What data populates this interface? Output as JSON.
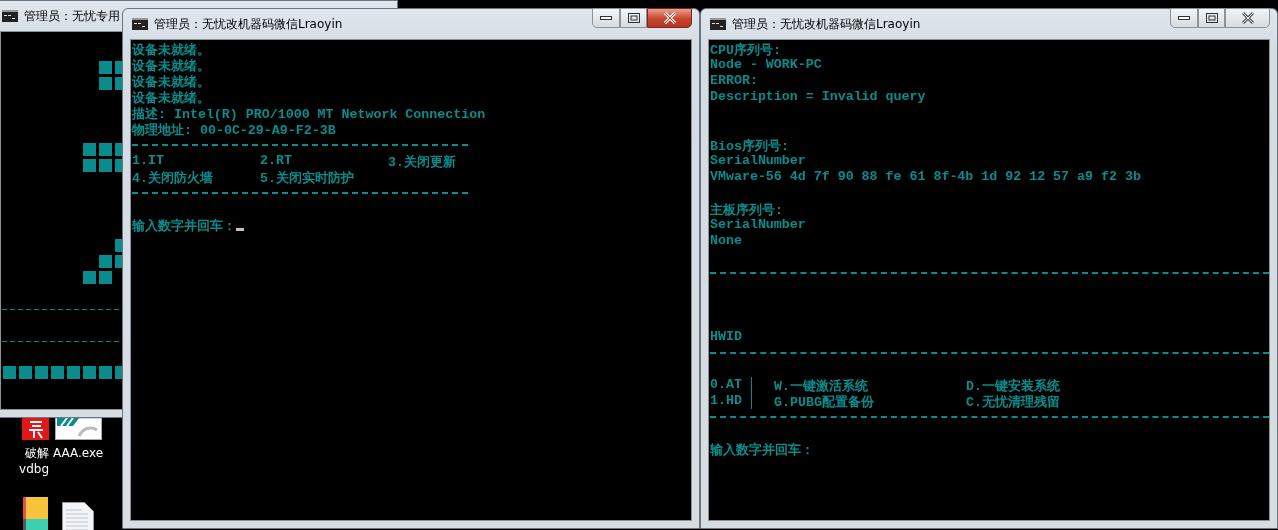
{
  "background_window": {
    "title": "管理员：无忧专用"
  },
  "desktop_icons": [
    {
      "kind": "red-app",
      "lines": [
        "破解",
        "vdbg"
      ]
    },
    {
      "kind": "installer",
      "lines": [
        "AAA.exe"
      ]
    },
    {
      "kind": "tiles"
    },
    {
      "kind": "document"
    }
  ],
  "windows": [
    {
      "title": "管理员：无忧改机器码微信Lraoyin",
      "active": true,
      "lines": [
        {
          "kind": "text",
          "text": "设备未就绪。"
        },
        {
          "kind": "text",
          "text": "设备未就绪。"
        },
        {
          "kind": "text",
          "text": "设备未就绪。"
        },
        {
          "kind": "text",
          "text": "设备未就绪。"
        },
        {
          "kind": "text",
          "text": "描述: Intel(R) PRO/1000 MT Network Connection"
        },
        {
          "kind": "text",
          "text": "物理地址: 00-0C-29-A9-F2-3B"
        },
        {
          "kind": "rule"
        },
        {
          "kind": "menu",
          "divided": false,
          "rows": [
            [
              "1.IT",
              "2.RT",
              "3.关闭更新"
            ],
            [
              "4.关闭防火墙",
              "5.关闭实时防护"
            ]
          ]
        },
        {
          "kind": "rule"
        },
        {
          "kind": "blank"
        },
        {
          "kind": "prompt",
          "text": "输入数字并回车：",
          "cursor": true
        }
      ]
    },
    {
      "title": "管理员：无忧改机器码微信Lraoyin",
      "active": false,
      "lines": [
        {
          "kind": "text",
          "text": "CPU序列号:"
        },
        {
          "kind": "text",
          "text": "Node - WORK-PC"
        },
        {
          "kind": "text",
          "text": "ERROR:"
        },
        {
          "kind": "text",
          "text": "Description = Invalid query"
        },
        {
          "kind": "blank"
        },
        {
          "kind": "blank"
        },
        {
          "kind": "text",
          "text": "Bios序列号:"
        },
        {
          "kind": "text",
          "text": "SerialNumber"
        },
        {
          "kind": "text",
          "text": "VMware-56 4d 7f 90 88 fe 61 8f-4b 1d 92 12 57 a9 f2 3b"
        },
        {
          "kind": "blank"
        },
        {
          "kind": "text",
          "text": "主板序列号:"
        },
        {
          "kind": "text",
          "text": "SerialNumber"
        },
        {
          "kind": "text",
          "text": "None"
        },
        {
          "kind": "blank"
        },
        {
          "kind": "rule"
        },
        {
          "kind": "blank"
        },
        {
          "kind": "blank"
        },
        {
          "kind": "blank"
        },
        {
          "kind": "text",
          "text": "HWID"
        },
        {
          "kind": "rule"
        },
        {
          "kind": "blank"
        },
        {
          "kind": "menu",
          "divided": true,
          "rows": [
            [
              "0.AT",
              "W.一键激活系统",
              "D.一键安装系统"
            ],
            [
              "1.HD",
              "G.PUBG配置备份",
              "C.无忧清理残留"
            ]
          ]
        },
        {
          "kind": "rule"
        },
        {
          "kind": "blank"
        },
        {
          "kind": "prompt",
          "text": "输入数字并回车：",
          "cursor": false
        }
      ]
    }
  ]
}
